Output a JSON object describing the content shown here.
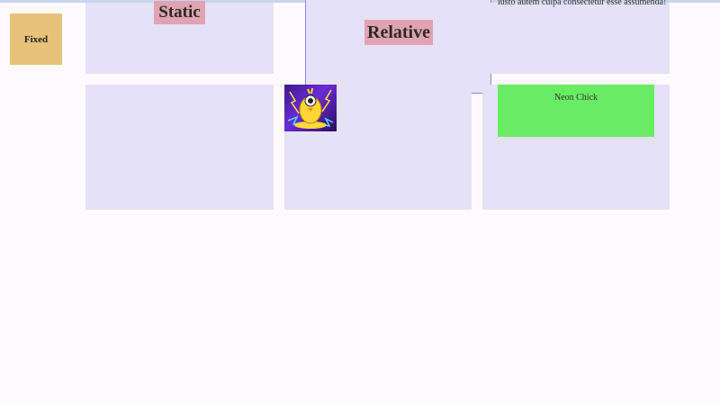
{
  "fixed": {
    "label": "Fixed"
  },
  "static": {
    "label": "Static"
  },
  "relative": {
    "label": "Relative"
  },
  "lorem_text": "iusto autem culpa consectetur esse assumenda!",
  "neon": {
    "caption": "Neon Chick",
    "image_alt": "Neon Chick"
  },
  "colors": {
    "card": "#e5e1f6",
    "label": "#e0a3b3",
    "fixed": "#e6c27a",
    "green": "#68ec63",
    "border": "#8b86d4"
  }
}
